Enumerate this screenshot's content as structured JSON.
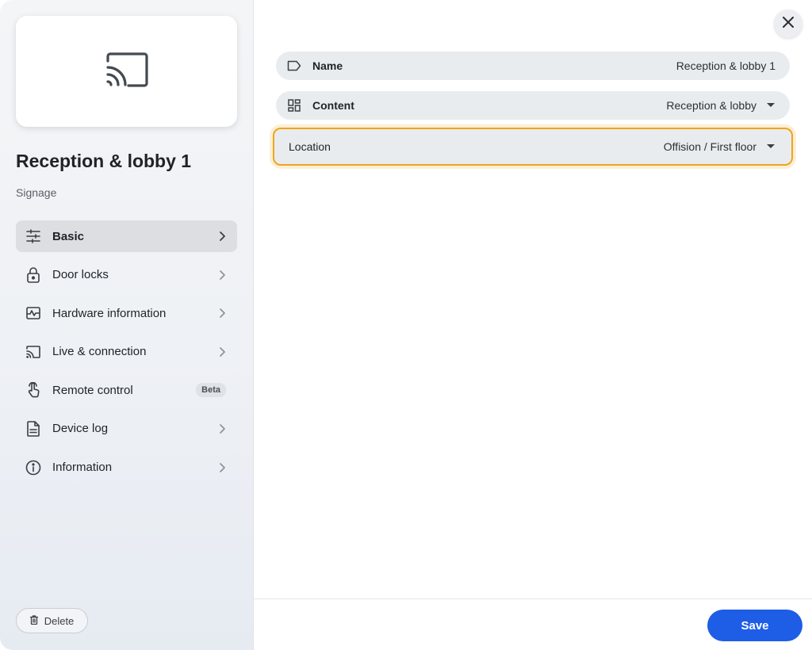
{
  "device": {
    "title": "Reception & lobby 1",
    "type": "Signage",
    "preview_icon": "cast-icon"
  },
  "nav": {
    "items": [
      {
        "label": "Basic",
        "icon": "sliders-icon",
        "active": true
      },
      {
        "label": "Door locks",
        "icon": "lock-icon"
      },
      {
        "label": "Hardware information",
        "icon": "hardware-chart-icon"
      },
      {
        "label": "Live & connection",
        "icon": "cast-icon"
      },
      {
        "label": "Remote control",
        "icon": "touch-icon",
        "badge": "Beta"
      },
      {
        "label": "Device log",
        "icon": "document-icon"
      },
      {
        "label": "Information",
        "icon": "info-icon"
      }
    ]
  },
  "actions": {
    "delete_label": "Delete",
    "save_label": "Save"
  },
  "fields": {
    "name": {
      "label": "Name",
      "value": "Reception & lobby 1",
      "icon": "tag-icon"
    },
    "content": {
      "label": "Content",
      "value": "Reception & lobby",
      "icon": "layout-icon"
    },
    "location": {
      "label": "Location",
      "value": "Offision / First floor"
    }
  },
  "colors": {
    "accent": "#1e5de6",
    "focus_outline": "#efa51c",
    "field_bg": "#e9ecef",
    "active_nav_bg": "#dcdee2"
  }
}
